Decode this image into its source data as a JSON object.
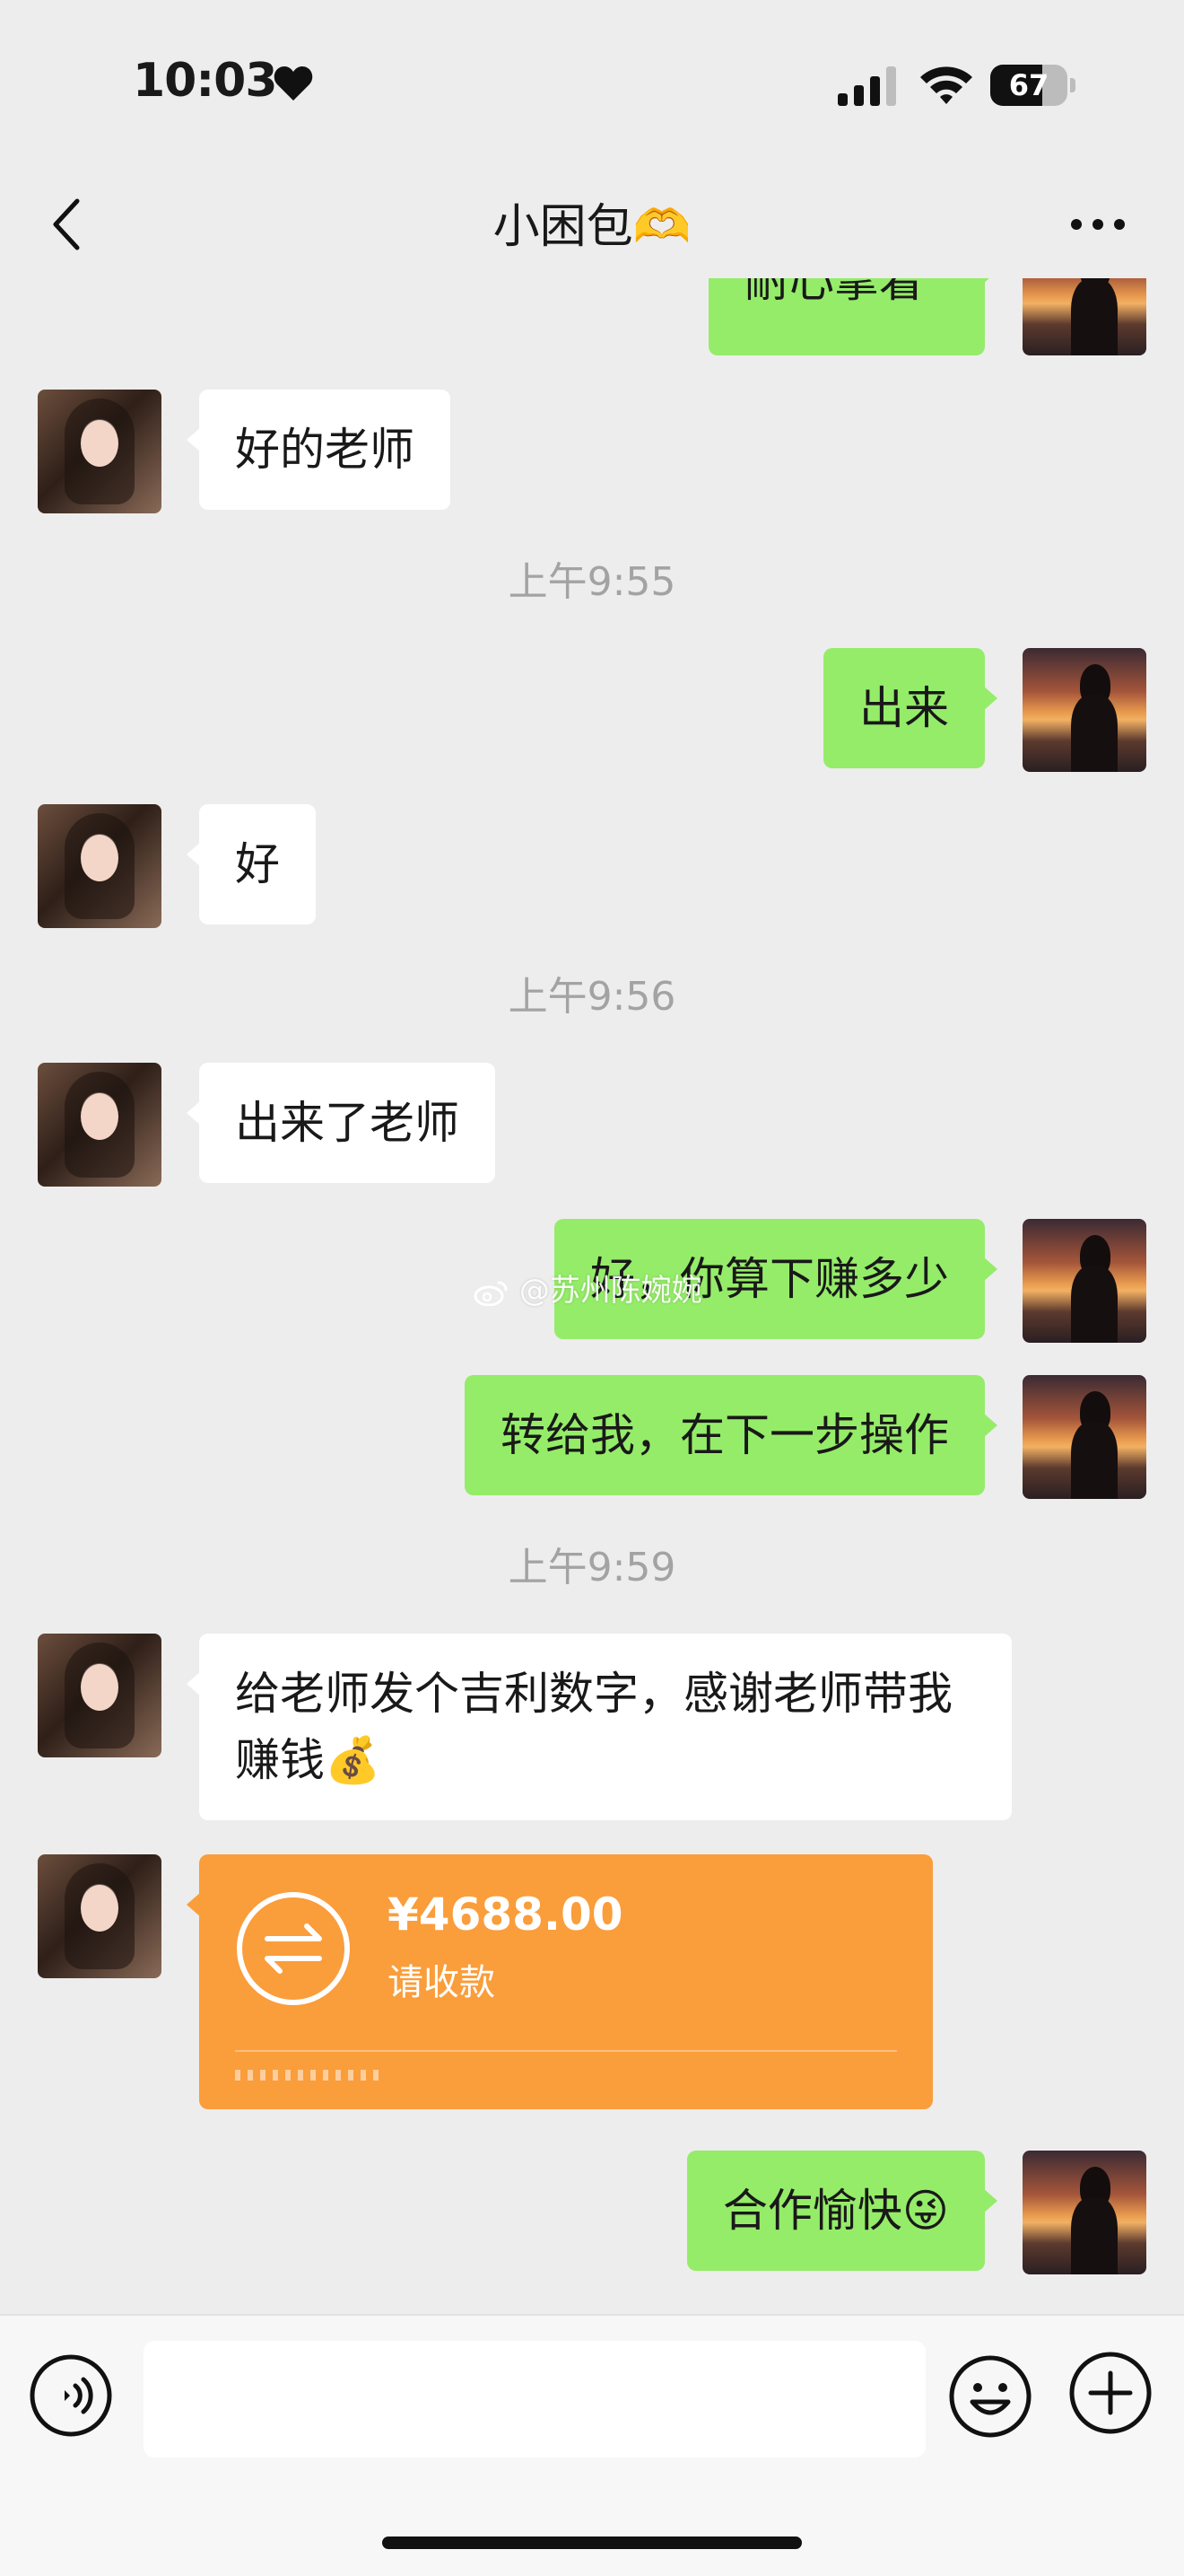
{
  "status_bar": {
    "time": "10:03",
    "battery_level": "67",
    "battery_fraction": 0.67
  },
  "nav": {
    "title": "小困包🫶",
    "back_icon": "chevron-left-icon",
    "more_icon": "more-dots-icon"
  },
  "messages": [
    {
      "side": "right",
      "text": "耐心拿着"
    },
    {
      "side": "left",
      "text": "好的老师"
    },
    {
      "type": "time",
      "text": "上午9:55"
    },
    {
      "side": "right",
      "text": "出来"
    },
    {
      "side": "left",
      "text": "好"
    },
    {
      "type": "time",
      "text": "上午9:56"
    },
    {
      "side": "left",
      "text": "出来了老师"
    },
    {
      "side": "right",
      "text": "好，你算下赚多少"
    },
    {
      "side": "right",
      "text": "转给我，在下一步操作"
    },
    {
      "type": "time",
      "text": "上午9:59"
    },
    {
      "side": "left",
      "text": "给老师发个吉利数字，感谢老师带我赚钱💰"
    },
    {
      "side": "left",
      "type": "transfer",
      "amount": "¥4688.00",
      "status": "请收款"
    },
    {
      "side": "right",
      "text": "合作愉快😜"
    }
  ],
  "watermark": "@苏州陈婉婉",
  "input_bar": {
    "voice_icon": "voice-icon",
    "emoji_icon": "emoji-icon",
    "plus_icon": "plus-icon",
    "input_value": ""
  },
  "colors": {
    "background": "#ededed",
    "bubble_green": "#95ec69",
    "bubble_white": "#ffffff",
    "transfer_orange": "#fa9d3b",
    "timestamp_gray": "#a3a3a3"
  }
}
